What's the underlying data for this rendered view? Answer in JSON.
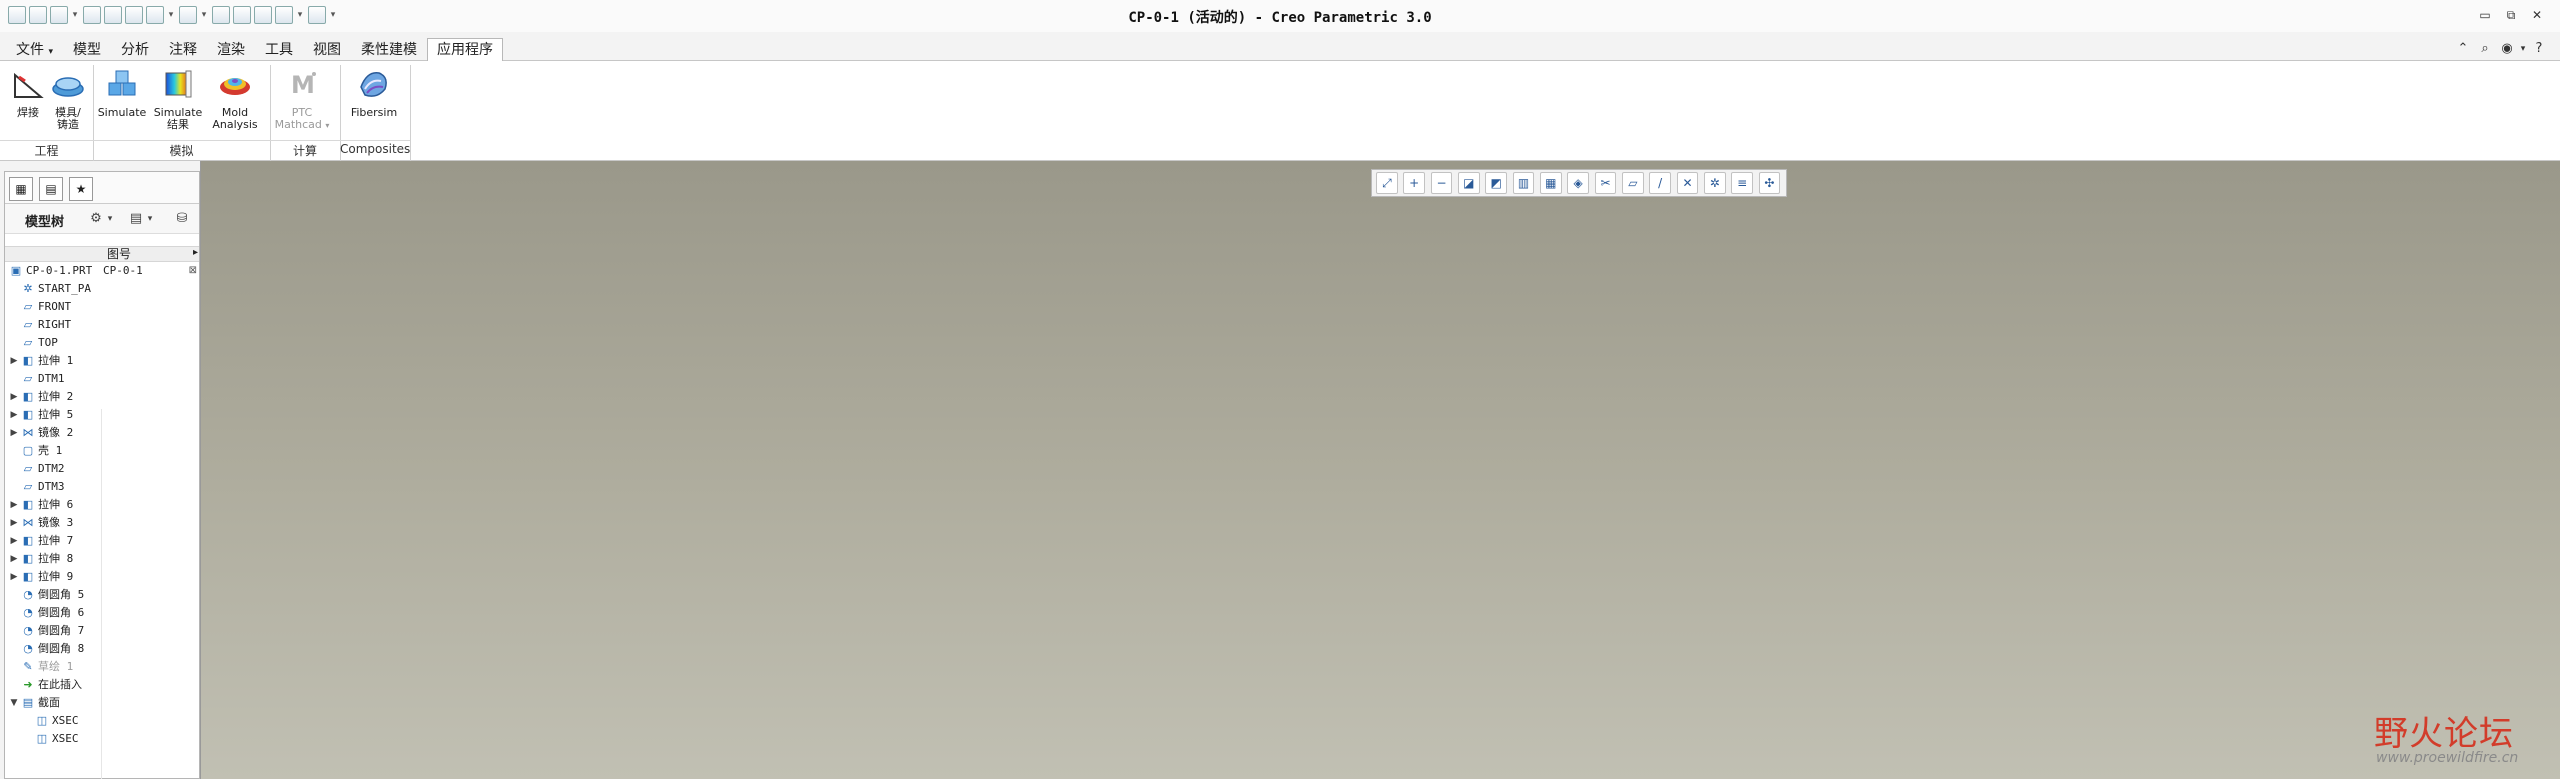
{
  "window": {
    "title": "CP-0-1 (活动的) - Creo Parametric 3.0",
    "controls": [
      "▭",
      "⧉",
      "✕"
    ]
  },
  "menu_tabs": [
    {
      "label": "文件",
      "active": false
    },
    {
      "label": "模型",
      "active": false
    },
    {
      "label": "分析",
      "active": false
    },
    {
      "label": "注释",
      "active": false
    },
    {
      "label": "渲染",
      "active": false
    },
    {
      "label": "工具",
      "active": false
    },
    {
      "label": "视图",
      "active": false
    },
    {
      "label": "柔性建模",
      "active": false
    },
    {
      "label": "应用程序",
      "active": true
    }
  ],
  "file_menu_arrow": "▾",
  "ribbon": {
    "buttons": [
      {
        "label1": "焊接",
        "label2": "",
        "icon": "weld-icon"
      },
      {
        "label1": "模具/",
        "label2": "铸造",
        "icon": "mold-casting-icon"
      },
      {
        "label1": "Simulate",
        "label2": "",
        "icon": "simulate-icon"
      },
      {
        "label1": "Simulate",
        "label2": "结果",
        "icon": "simulate-results-icon"
      },
      {
        "label1": "Mold",
        "label2": "Analysis",
        "icon": "mold-analysis-icon"
      },
      {
        "label1": "PTC",
        "label2": "Mathcad",
        "icon": "mathcad-icon",
        "disabled": true
      },
      {
        "label1": "Fibersim",
        "label2": "",
        "icon": "fibersim-icon"
      }
    ],
    "groups": [
      "工程",
      "模拟",
      "计算",
      "Composites"
    ]
  },
  "model_tree": {
    "title": "模型树",
    "column_name": "图号",
    "column_more": "▸",
    "rows": [
      {
        "label": "CP-0-1.PRT",
        "col": "CP-0-1",
        "icon": "part-icon",
        "expand": "",
        "indent": 0
      },
      {
        "label": "START_PA",
        "col": "",
        "icon": "csys-icon",
        "expand": "",
        "indent": 1
      },
      {
        "label": "FRONT",
        "col": "",
        "icon": "datum-plane-icon",
        "expand": "",
        "indent": 1
      },
      {
        "label": "RIGHT",
        "col": "",
        "icon": "datum-plane-icon",
        "expand": "",
        "indent": 1
      },
      {
        "label": "TOP",
        "col": "",
        "icon": "datum-plane-icon",
        "expand": "",
        "indent": 1
      },
      {
        "label": "拉伸 1",
        "col": "",
        "icon": "extrude-icon",
        "expand": "▶",
        "indent": 1
      },
      {
        "label": "DTM1",
        "col": "",
        "icon": "datum-plane-icon",
        "expand": "",
        "indent": 1
      },
      {
        "label": "拉伸 2",
        "col": "",
        "icon": "extrude-icon",
        "expand": "▶",
        "indent": 1
      },
      {
        "label": "拉伸 5",
        "col": "",
        "icon": "extrude-icon",
        "expand": "▶",
        "indent": 1
      },
      {
        "label": "镜像 2",
        "col": "",
        "icon": "mirror-icon",
        "expand": "▶",
        "indent": 1
      },
      {
        "label": "壳 1",
        "col": "",
        "icon": "shell-icon",
        "expand": "",
        "indent": 1
      },
      {
        "label": "DTM2",
        "col": "",
        "icon": "datum-plane-icon",
        "expand": "",
        "indent": 1
      },
      {
        "label": "DTM3",
        "col": "",
        "icon": "datum-plane-icon",
        "expand": "",
        "indent": 1
      },
      {
        "label": "拉伸 6",
        "col": "",
        "icon": "extrude-icon",
        "expand": "▶",
        "indent": 1
      },
      {
        "label": "镜像 3",
        "col": "",
        "icon": "mirror-icon",
        "expand": "▶",
        "indent": 1
      },
      {
        "label": "拉伸 7",
        "col": "",
        "icon": "extrude-icon",
        "expand": "▶",
        "indent": 1
      },
      {
        "label": "拉伸 8",
        "col": "",
        "icon": "extrude-icon",
        "expand": "▶",
        "indent": 1
      },
      {
        "label": "拉伸 9",
        "col": "",
        "icon": "extrude-icon",
        "expand": "▶",
        "indent": 1
      },
      {
        "label": "倒圆角 5",
        "col": "",
        "icon": "round-icon",
        "expand": "",
        "indent": 1
      },
      {
        "label": "倒圆角 6",
        "col": "",
        "icon": "round-icon",
        "expand": "",
        "indent": 1
      },
      {
        "label": "倒圆角 7",
        "col": "",
        "icon": "round-icon",
        "expand": "",
        "indent": 1
      },
      {
        "label": "倒圆角 8",
        "col": "",
        "icon": "round-icon",
        "expand": "",
        "indent": 1
      },
      {
        "label": "草绘 1",
        "col": "",
        "icon": "sketch-icon",
        "expand": "",
        "indent": 1,
        "muted": true
      },
      {
        "label": "在此插入",
        "col": "",
        "icon": "insert-here-icon",
        "expand": "",
        "indent": 1
      },
      {
        "label": "截面",
        "col": "",
        "icon": "section-folder-icon",
        "expand": "▼",
        "indent": 1
      },
      {
        "label": "XSEC",
        "col": "",
        "icon": "xsec-icon",
        "expand": "",
        "indent": 2
      },
      {
        "label": "XSEC",
        "col": "",
        "icon": "xsec-icon",
        "expand": "",
        "indent": 2
      }
    ]
  },
  "graphics_toolbar": [
    "refit-icon",
    "zoom-in-icon",
    "zoom-out-icon",
    "repaint-icon",
    "display-style-icon",
    "saved-views-icon",
    "view-manager-icon",
    "perspective-icon",
    "section-view-icon",
    "plane-display-icon",
    "axis-display-icon",
    "point-display-icon",
    "csys-display-icon",
    "annotation-display-icon",
    "spin-center-icon"
  ],
  "watermark": {
    "main": "野火论坛",
    "sub": "www.proewildfire.cn"
  },
  "colors": {
    "graphics_top": "#9a988a",
    "graphics_bottom": "#c1c0b3",
    "watermark_red": "#d23c2a",
    "tree_icon_blue": "#2a6db4"
  }
}
